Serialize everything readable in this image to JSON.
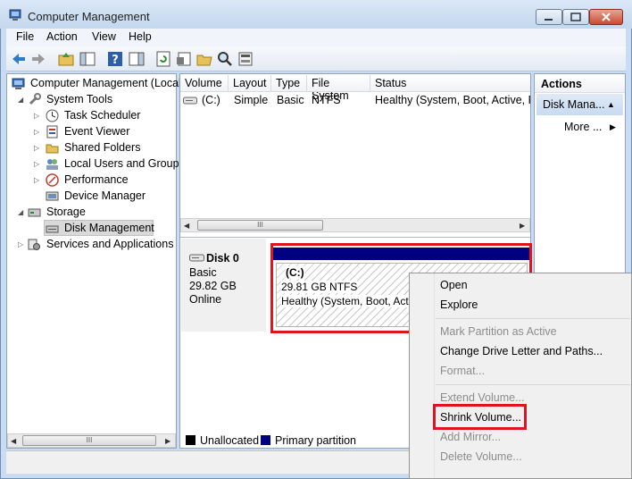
{
  "window": {
    "title": "Computer Management"
  },
  "menubar": {
    "items": [
      "File",
      "Action",
      "View",
      "Help"
    ]
  },
  "tree": {
    "root": "Computer Management (Local",
    "system_tools": "System Tools",
    "task_scheduler": "Task Scheduler",
    "event_viewer": "Event Viewer",
    "shared_folders": "Shared Folders",
    "local_users": "Local Users and Groups",
    "performance": "Performance",
    "device_manager": "Device Manager",
    "storage": "Storage",
    "disk_management": "Disk Management",
    "services": "Services and Applications",
    "scroll_thumb": "III"
  },
  "volume_table": {
    "headers": [
      "Volume",
      "Layout",
      "Type",
      "File System",
      "Status"
    ],
    "row": {
      "volume": "(C:)",
      "layout": "Simple",
      "type": "Basic",
      "file_system": "NTFS",
      "status": "Healthy (System, Boot, Active, Pr"
    },
    "scroll_thumb": "III"
  },
  "disk": {
    "name": "Disk 0",
    "type": "Basic",
    "size": "29.82 GB",
    "state": "Online",
    "volume_label": "(C:)",
    "volume_size": "29.81 GB NTFS",
    "volume_status": "Healthy (System, Boot, Acti"
  },
  "legend": {
    "unallocated": "Unallocated",
    "primary": "Primary partition"
  },
  "actions": {
    "header": "Actions",
    "selected": "Disk Mana...",
    "more": "More ..."
  },
  "context_menu": {
    "open": "Open",
    "explore": "Explore",
    "mark_active": "Mark Partition as Active",
    "change_letter": "Change Drive Letter and Paths...",
    "format": "Format...",
    "extend": "Extend Volume...",
    "shrink": "Shrink Volume...",
    "add_mirror": "Add Mirror...",
    "delete": "Delete Volume..."
  },
  "colors": {
    "primary_partition": "#000080",
    "unallocated": "#000000",
    "highlight_red": "#e0141e"
  }
}
